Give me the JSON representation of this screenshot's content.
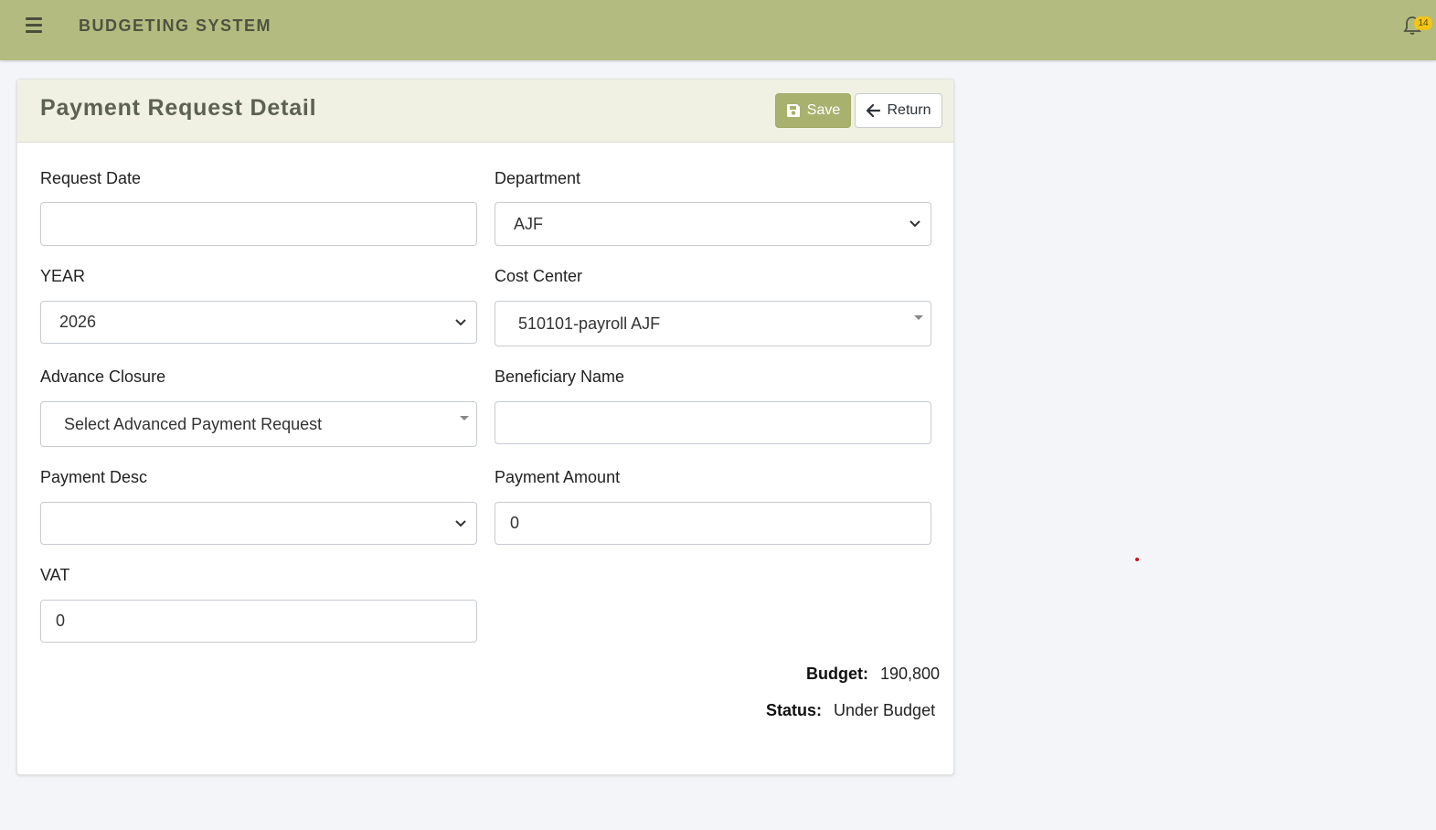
{
  "app": {
    "brand": "BUDGETING SYSTEM",
    "notification_count": "14",
    "colors": {
      "topbar": "#b3bb80",
      "accent": "#a9b16e",
      "badge": "#f2c516"
    }
  },
  "page": {
    "title": "Payment Request Detail",
    "save_label": "Save",
    "return_label": "Return"
  },
  "form": {
    "request_date": {
      "label": "Request Date",
      "value": ""
    },
    "department": {
      "label": "Department",
      "value": "AJF"
    },
    "year": {
      "label": "YEAR",
      "value": "2026"
    },
    "cost_center": {
      "label": "Cost Center",
      "value": "510101-payroll AJF"
    },
    "advance_closure": {
      "label": "Advance Closure",
      "value": "Select Advanced Payment Request"
    },
    "beneficiary_name": {
      "label": "Beneficiary Name",
      "value": ""
    },
    "payment_desc": {
      "label": "Payment Desc",
      "value": ""
    },
    "payment_amount": {
      "label": "Payment Amount",
      "value": "0"
    },
    "vat": {
      "label": "VAT",
      "value": "0"
    }
  },
  "summary": {
    "budget_label": "Budget:",
    "budget_value": "190,800",
    "status_label": "Status:",
    "status_value": "Under Budget"
  }
}
